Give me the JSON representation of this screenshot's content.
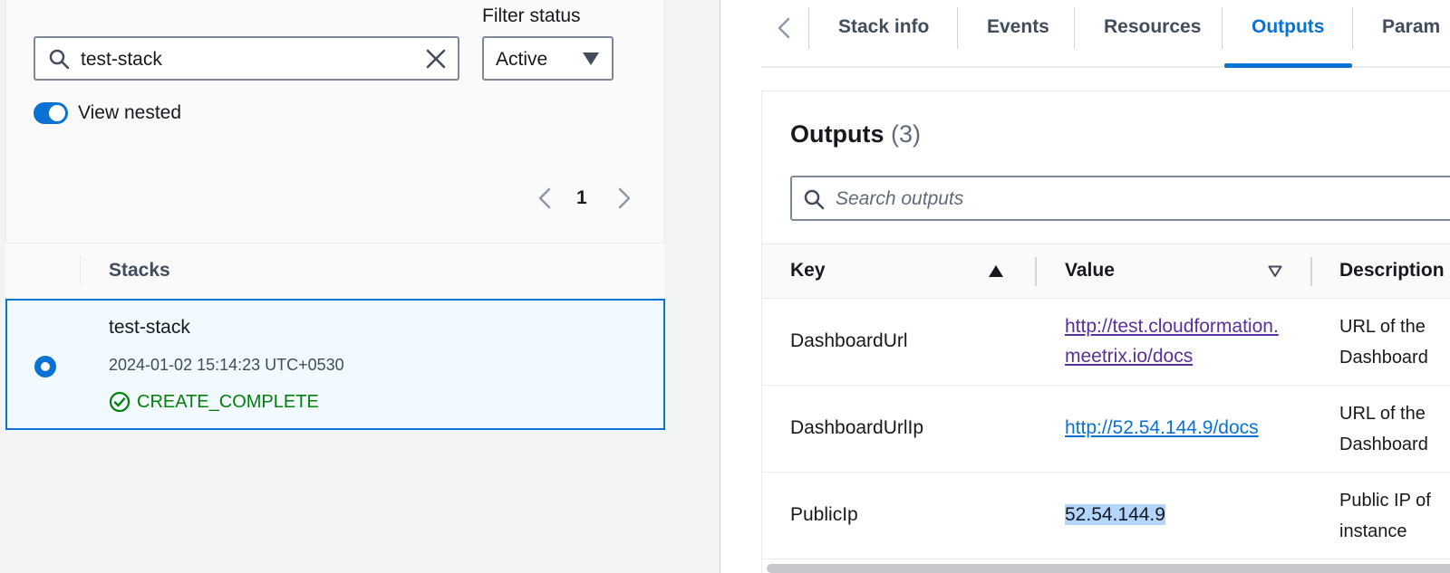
{
  "left": {
    "filter_label": "Filter status",
    "search_value": "test-stack",
    "status_select": "Active",
    "toggle_label": "View nested",
    "page_number": "1",
    "column_header": "Stacks",
    "stack": {
      "name": "test-stack",
      "date": "2024-01-02 15:14:23 UTC+0530",
      "status": "CREATE_COMPLETE"
    }
  },
  "tabs": [
    "Stack info",
    "Events",
    "Resources",
    "Outputs",
    "Param"
  ],
  "outputs": {
    "title": "Outputs",
    "count": "(3)",
    "search_placeholder": "Search outputs",
    "headers": {
      "key": "Key",
      "value": "Value",
      "description": "Description"
    },
    "rows": [
      {
        "key": "DashboardUrl",
        "value": "http://test.cloudformation.meetrix.io/docs",
        "desc1": "URL of the",
        "desc2": "Dashboard"
      },
      {
        "key": "DashboardUrlIp",
        "value": "http://52.54.144.9/docs",
        "desc1": "URL of the",
        "desc2": "Dashboard"
      },
      {
        "key": "PublicIp",
        "value": "52.54.144.9",
        "desc1": "Public IP of",
        "desc2": "instance"
      }
    ]
  },
  "colors": {
    "accent": "#0972d3",
    "success": "#037f0c",
    "visited_link": "#5b2f9c",
    "selection_bg": "#f1faff"
  }
}
